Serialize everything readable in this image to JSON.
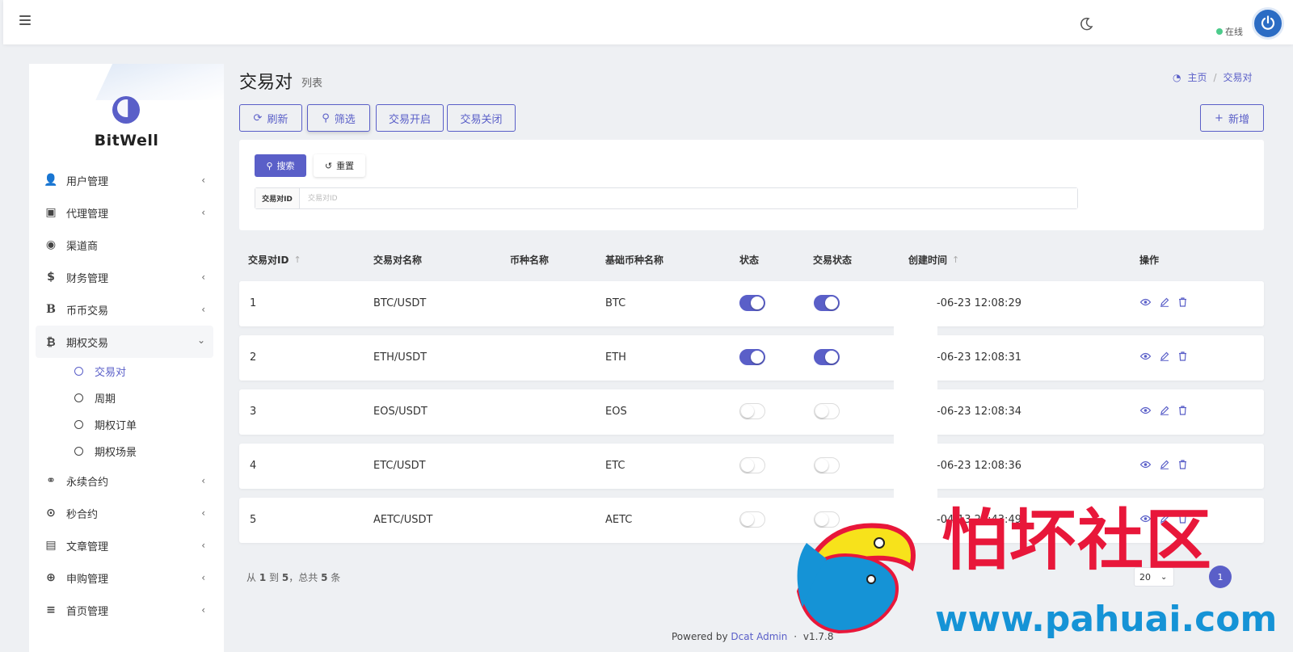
{
  "topbar": {
    "online_label": "在线"
  },
  "sidebar": {
    "brand": "BitWell",
    "items": [
      {
        "label": "用户管理",
        "icon": "user-tie-icon"
      },
      {
        "label": "代理管理",
        "icon": "id-card-icon"
      },
      {
        "label": "渠道商",
        "icon": "user-circle-icon"
      },
      {
        "label": "财务管理",
        "icon": "dollar-icon"
      },
      {
        "label": "币币交易",
        "icon": "bold-b-icon"
      },
      {
        "label": "期权交易",
        "icon": "bitcoin-icon"
      },
      {
        "label": "永续合约",
        "icon": "link-icon"
      },
      {
        "label": "秒合约",
        "icon": "dot-circle-icon"
      },
      {
        "label": "文章管理",
        "icon": "newspaper-icon"
      },
      {
        "label": "申购管理",
        "icon": "life-ring-icon"
      },
      {
        "label": "首页管理",
        "icon": "list-icon"
      }
    ],
    "subitems": [
      {
        "label": "交易对"
      },
      {
        "label": "周期"
      },
      {
        "label": "期权订单"
      },
      {
        "label": "期权场景"
      }
    ]
  },
  "page": {
    "title": "交易对",
    "subtitle": "列表"
  },
  "breadcrumb": {
    "home": "主页",
    "current": "交易对"
  },
  "toolbar": {
    "refresh": "刷新",
    "filter": "筛选",
    "open_trading": "交易开启",
    "close_trading": "交易关闭",
    "add": "新增"
  },
  "filter": {
    "search": "搜索",
    "reset": "重置",
    "field_label": "交易对ID",
    "placeholder": "交易对ID"
  },
  "table": {
    "headers": [
      "交易对ID",
      "交易对名称",
      "币种名称",
      "基础币种名称",
      "状态",
      "交易状态",
      "创建时间",
      "操作"
    ],
    "rows": [
      {
        "id": "1",
        "name": "BTC/USDT",
        "coin": "",
        "base": "BTC",
        "status": true,
        "trade_status": true,
        "created": "-06-23 12:08:29"
      },
      {
        "id": "2",
        "name": "ETH/USDT",
        "coin": "",
        "base": "ETH",
        "status": true,
        "trade_status": true,
        "created": "-06-23 12:08:31"
      },
      {
        "id": "3",
        "name": "EOS/USDT",
        "coin": "",
        "base": "EOS",
        "status": false,
        "trade_status": false,
        "created": "-06-23 12:08:34"
      },
      {
        "id": "4",
        "name": "ETC/USDT",
        "coin": "",
        "base": "ETC",
        "status": false,
        "trade_status": false,
        "created": "-06-23 12:08:36"
      },
      {
        "id": "5",
        "name": "AETC/USDT",
        "coin": "",
        "base": "AETC",
        "status": false,
        "trade_status": false,
        "created": "-04-13 23:43:49"
      }
    ]
  },
  "pagination": {
    "from_word": "从",
    "from": "1",
    "to_word": "到",
    "to": "5",
    "total_word": "，总共",
    "total": "5",
    "unit": "条",
    "per_page": "20",
    "current_page": "1"
  },
  "footer": {
    "powered": "Powered by",
    "link": "Dcat Admin",
    "sep": "·",
    "version": "v1.7.8"
  },
  "watermark": {
    "cn": "怕坏社区",
    "url": "www.pahuai.com"
  },
  "colors": {
    "accent": "#5a5fc8",
    "online": "#4ccb8b",
    "watermark_red": "#e8173a",
    "watermark_blue": "#1593d6"
  }
}
